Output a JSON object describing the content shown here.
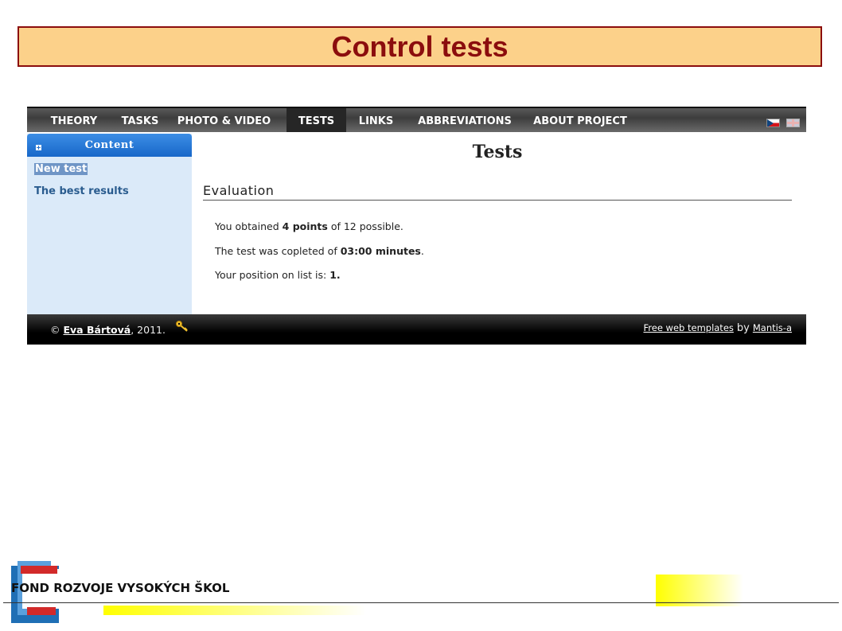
{
  "slide": {
    "title": "Control tests"
  },
  "nav": {
    "items": [
      "THEORY",
      "TASKS",
      "PHOTO & VIDEO",
      "TESTS",
      "LINKS",
      "ABBREVIATIONS",
      "ABOUT PROJECT"
    ],
    "active": "TESTS",
    "flags": [
      "czech-flag-icon",
      "english-flag-icon"
    ]
  },
  "sidebar": {
    "heading": "Content",
    "heading_icon": "plus-icon",
    "links": [
      "New test",
      "The best results"
    ]
  },
  "main": {
    "page_title": "Tests",
    "section_title": "Evaluation",
    "line1": {
      "pre": "You obtained ",
      "bold": "4 points",
      "post": " of 12 possible."
    },
    "line2": {
      "pre": "The test was copleted of ",
      "bold": "03:00 minutes",
      "post": "."
    },
    "line3": {
      "pre": "Your position on list is: ",
      "bold": "1.",
      "post": ""
    }
  },
  "footer": {
    "copyright_symbol": "©",
    "author": "Eva Bártová",
    "year_text": ", 2011.",
    "icon": "key-icon",
    "templates_link": "Free web templates",
    "by": "by",
    "mantis_link": "Mantis-a"
  },
  "branding": {
    "fund_name": "FOND ROZVOJE VYSOKÝCH ŠKOL",
    "colors": {
      "title_red": "#8b0d0d",
      "title_bg": "#fcd18a",
      "accent_blue": "#1767c9",
      "yellow": "#ffff00"
    }
  }
}
